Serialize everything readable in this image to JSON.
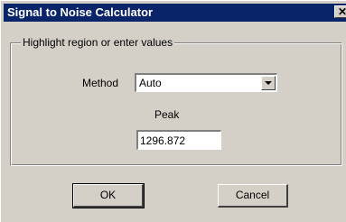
{
  "window": {
    "title": "Signal to Noise Calculator",
    "close_glyph": "✕"
  },
  "group": {
    "label": "Highlight region or enter values"
  },
  "method": {
    "label": "Method",
    "value": "Auto"
  },
  "peak": {
    "label": "Peak",
    "value": "1296.872"
  },
  "buttons": {
    "ok": "OK",
    "cancel": "Cancel"
  },
  "colors": {
    "titlebar": "#0a246a",
    "dialog_face": "#d4d0c8"
  }
}
